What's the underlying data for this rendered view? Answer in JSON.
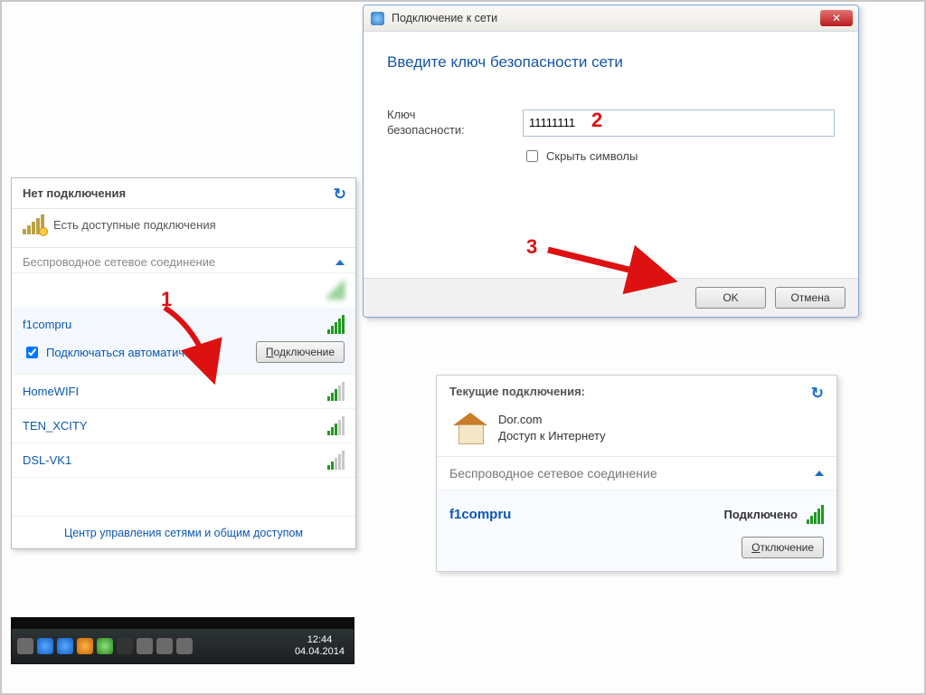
{
  "panel1": {
    "title": "Нет подключения",
    "available_msg": "Есть доступные подключения",
    "section": "Беспроводное сетевое соединение",
    "networks": {
      "masked": " ",
      "selected": "f1compru",
      "home": "HomeWIFI",
      "ten": "TEN_XCITY",
      "dsl": "DSL-VK1"
    },
    "auto_connect": "Подключаться автоматически",
    "connect_btn": "Подключение",
    "footer_link": "Центр управления сетями и общим доступом"
  },
  "taskbar": {
    "time": "12:44",
    "date": "04.04.2014"
  },
  "panel2": {
    "window_title": "Подключение к сети",
    "heading": "Введите ключ безопасности сети",
    "key_label_l1": "Ключ",
    "key_label_l2": "безопасности:",
    "key_value": "11111111",
    "hide_label": "Скрыть символы",
    "ok": "OK",
    "cancel": "Отмена"
  },
  "panel3": {
    "title": "Текущие подключения:",
    "conn_name": "Dor.com",
    "conn_state": "Доступ к Интернету",
    "section": "Беспроводное сетевое соединение",
    "sel_name": "f1compru",
    "sel_state": "Подключено",
    "disconnect": "Отключение"
  },
  "ann": {
    "n1": "1",
    "n2": "2",
    "n3": "3"
  }
}
